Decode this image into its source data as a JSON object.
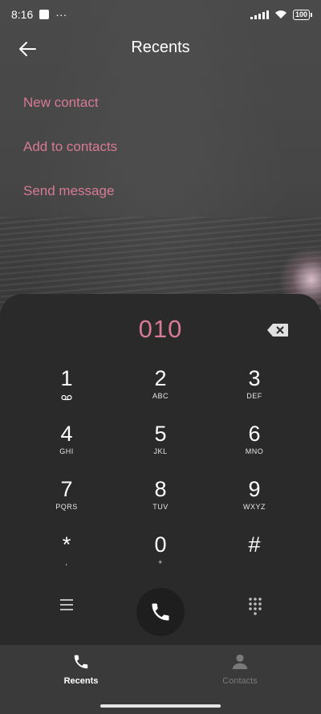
{
  "status": {
    "time": "8:16",
    "more": "···",
    "battery": "100"
  },
  "header": {
    "title": "Recents"
  },
  "options": [
    {
      "label": "New contact"
    },
    {
      "label": "Add to contacts"
    },
    {
      "label": "Send message"
    }
  ],
  "dialer": {
    "number": "010",
    "keys": [
      {
        "digit": "1",
        "letters": ""
      },
      {
        "digit": "2",
        "letters": "ABC"
      },
      {
        "digit": "3",
        "letters": "DEF"
      },
      {
        "digit": "4",
        "letters": "GHI"
      },
      {
        "digit": "5",
        "letters": "JKL"
      },
      {
        "digit": "6",
        "letters": "MNO"
      },
      {
        "digit": "7",
        "letters": "PQRS"
      },
      {
        "digit": "8",
        "letters": "TUV"
      },
      {
        "digit": "9",
        "letters": "WXYZ"
      },
      {
        "digit": "*",
        "letters": ","
      },
      {
        "digit": "0",
        "letters": "+"
      },
      {
        "digit": "#",
        "letters": ""
      }
    ]
  },
  "nav": {
    "recents": "Recents",
    "contacts": "Contacts"
  },
  "colors": {
    "accent": "#d77a95",
    "panel": "#2a2a2a",
    "nav": "#3a3a3a"
  }
}
